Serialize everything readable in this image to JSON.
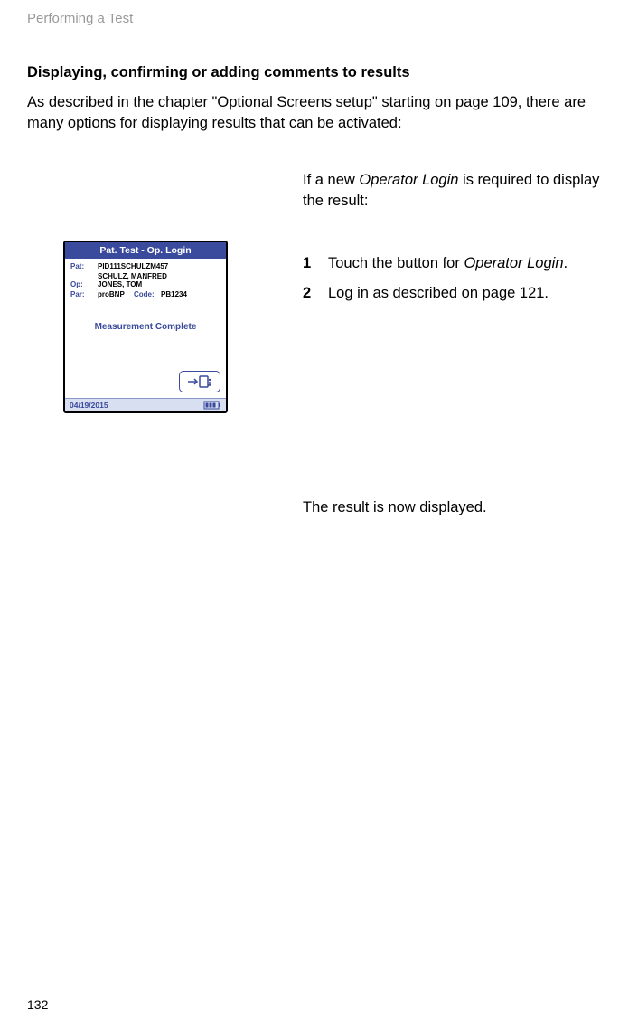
{
  "header": {
    "section": "Performing a Test"
  },
  "title": "Displaying, confirming or adding comments to results",
  "intro": "As described in the chapter \"Optional Screens setup\" starting on page 109, there are many options for displaying results that can be activated:",
  "preDeviceText": {
    "before": "If a new ",
    "italic": "Operator Login",
    "after": " is required to display the result:"
  },
  "steps": [
    {
      "num": "1",
      "before": "Touch the button for ",
      "italic": "Operator Login",
      "after": "."
    },
    {
      "num": "2",
      "before": "Log in as described on page 121.",
      "italic": "",
      "after": ""
    }
  ],
  "postText": "The result is now displayed.",
  "device": {
    "title": "Pat. Test - Op. Login",
    "pat_label": "Pat:",
    "pat_value": "PID111SCHULZM457",
    "pat_name": "SCHULZ, MANFRED",
    "op_label": "Op:",
    "op_value": "JONES, TOM",
    "par_label": "Par:",
    "par_value": "proBNP",
    "code_label": "Code:",
    "code_value": "PB1234",
    "message": "Measurement Complete",
    "date": "04/19/2015"
  },
  "pageNumber": "132"
}
